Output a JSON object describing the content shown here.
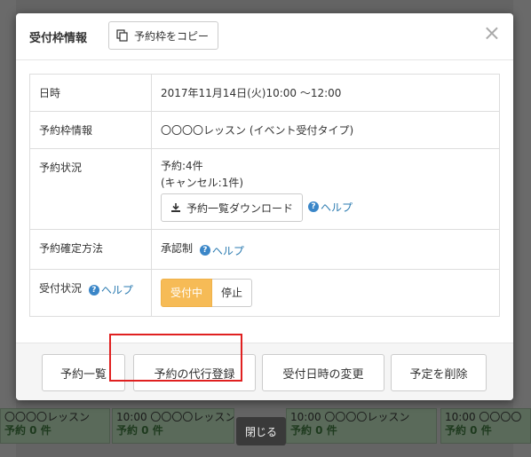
{
  "background": {
    "tiles": [
      {
        "label": "〇〇〇〇レッスン",
        "count": "予約 0 件"
      },
      {
        "label": "10:00 〇〇〇〇レッスン",
        "count": "予約 0 件"
      },
      {
        "label": "10:00 〇〇〇〇レッスン",
        "count": "予約 0 件"
      },
      {
        "label": "10:00 〇〇〇〇",
        "count": "予約 0 件"
      }
    ]
  },
  "modal": {
    "title": "受付枠情報",
    "copy_button_label": "予約枠をコピー",
    "close_glyph": "×",
    "rows": {
      "datetime": {
        "label": "日時",
        "value": "2017年11月14日(火)10:00 〜12:00"
      },
      "slot_info": {
        "label": "予約枠情報",
        "value": "〇〇〇〇レッスン (イベント受付タイプ)"
      },
      "status": {
        "label": "予約状況",
        "count": "予約:4件",
        "cancel": "(キャンセル:1件)",
        "download_label": "予約一覧ダウンロード",
        "help": "ヘルプ"
      },
      "confirm_method": {
        "label": "予約確定方法",
        "value": "承認制",
        "help": "ヘルプ"
      },
      "accept_status": {
        "label": "受付状況",
        "help": "ヘルプ",
        "on_label": "受付中",
        "off_label": "停止"
      }
    },
    "footer": {
      "list_label": "予約一覧",
      "proxy_label": "予約の代行登録",
      "change_label": "受付日時の変更",
      "delete_label": "予定を削除"
    }
  },
  "bottom_close_label": "閉じる",
  "colors": {
    "accent_on": "#f6bb56",
    "help_link": "#2a7ab0",
    "highlight": "#e02020"
  }
}
